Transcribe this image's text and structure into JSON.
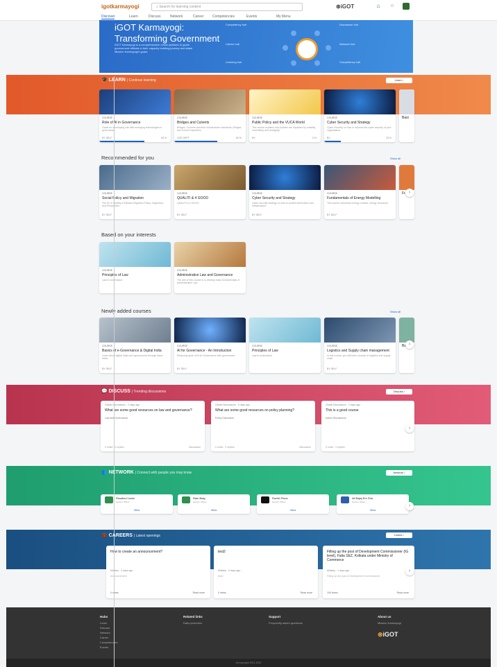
{
  "header": {
    "logo": "igotkarmayogi",
    "search_placeholder": "Search for learning content",
    "brand": "iGOT",
    "nav": [
      "Discover",
      "Learn",
      "Discuss",
      "Network",
      "Career",
      "Competencies",
      "Events",
      "My Menu"
    ]
  },
  "hero": {
    "title_line1": "iGOT Karmayogi:",
    "title_line2": "Transforming Government",
    "description": "iGOT Karmayogi is a comprehensive online platform to guide government officials in their capacity building journey and attain Mission Karmayogi's goals.",
    "labels": [
      "Competency hub",
      "Discussion hub",
      "Career hub",
      "Network hub",
      "Learning hub",
      "Competency hub"
    ]
  },
  "learn": {
    "title": "LEARN",
    "subtitle": "Continue learning",
    "button": "Learn",
    "cards": [
      {
        "tag": "COURSE",
        "title": "Role of AI in Governance",
        "desc": "Guide for developing role with emerging technologies in governance.",
        "meta": "BY SELF",
        "progress": "63 %"
      },
      {
        "tag": "COURSE",
        "title": "Bridges and Culverts",
        "desc": "Bridges, Culverts and their maintenance standards, Bridges and Culvert Inspection",
        "meta": "CDE DEPT",
        "progress": "60 %"
      },
      {
        "tag": "COURSE",
        "title": "Public Policy and the VUCA World",
        "desc": "This course explains how policies are impacted by volatility, uncertainty and ambiguity.",
        "meta": "BV",
        "progress": "0 %"
      },
      {
        "tag": "COURSE",
        "title": "Cyber Security and Strategy",
        "desc": "Cyber Security on how to improve the cyber security of your organisation.",
        "meta": "BV",
        "progress": "23 %"
      },
      {
        "tag": "COURSE",
        "title": "Basi",
        "desc": "",
        "meta": "",
        "progress": ""
      }
    ]
  },
  "recommended": {
    "title": "Recommended for you",
    "see_all": "Show all",
    "cards": [
      {
        "tag": "COURSE",
        "title": "Social Policy and Migration",
        "desc": "The IIC & Mobility & Efficient Migration Policy: Objectives and Perspective",
        "meta": "BY SELF"
      },
      {
        "tag": "COURSE",
        "title": "QUALITI & 4 GOOD",
        "desc": "QUALITI & 4 GOOD",
        "meta": "BY SELF"
      },
      {
        "tag": "COURSE",
        "title": "Cyber Security and Strategy",
        "desc": "Cyber security strategy on how to protect information and infrastructure",
        "meta": "BY SELF"
      },
      {
        "tag": "COURSE",
        "title": "Fundamentals of Energy Modelling",
        "desc": "This course introduces energy models, energy resources",
        "meta": "BY SELF"
      },
      {
        "tag": "COURSE",
        "title": "Fram",
        "desc": "",
        "meta": ""
      }
    ]
  },
  "interests": {
    "title": "Based on your interests",
    "cards": [
      {
        "tag": "COURSE",
        "title": "Principles of Law",
        "desc": "Law to understand",
        "meta": ""
      },
      {
        "tag": "COURSE",
        "title": "Administrative Law and Governance",
        "desc": "The aim of this course is to develop basic fundamentals of Administrative Law",
        "meta": ""
      }
    ]
  },
  "newly": {
    "title": "Newly added courses",
    "see_all": "Show all",
    "cards": [
      {
        "tag": "COURSE",
        "title": "Basics of e-Governance & Digital India",
        "desc": "Learn about digital India and egovernance through basic ideas",
        "meta": "BY SELF"
      },
      {
        "tag": "COURSE",
        "title": "AI for Governance - An Introduction",
        "desc": "Reducing cycle of AI for Governance with government",
        "meta": "BY SELF"
      },
      {
        "tag": "COURSE",
        "title": "Principles of Law",
        "desc": "Law to understand",
        "meta": ""
      },
      {
        "tag": "COURSE",
        "title": "Logistics and Supply chain management",
        "desc": "In this course, you will learn concept of logistics and supply chain",
        "meta": "BY SELF"
      },
      {
        "tag": "COURSE",
        "title": "Basi",
        "desc": "",
        "meta": ""
      }
    ]
  },
  "discuss": {
    "title": "DISCUSS",
    "subtitle": "Trending discussions",
    "button": "Discuss",
    "cards": [
      {
        "by": "Global Discussions · 2 days ago",
        "question": "What are some good resources on law and governance?",
        "category": "Law and Governance",
        "upvotes": "0 votes",
        "replies": "0 replies",
        "posted": "Discussion"
      },
      {
        "by": "Global Discussions · 5 days ago",
        "question": "What are some good resources on policy planning?",
        "category": "Policy Discussion",
        "upvotes": "0 votes",
        "replies": "0 replies",
        "posted": "Discussion"
      },
      {
        "by": "Global Discussions · 2 days ago",
        "question": "This is a good course",
        "category": "Admin Discussions",
        "upvotes": "0 votes",
        "replies": "0 replies",
        "posted": "Discussion"
      }
    ]
  },
  "network": {
    "title": "NETWORK",
    "subtitle": "Connect with people you may know",
    "button": "Network",
    "people": [
      {
        "initials": "RL",
        "name": "Rosalind Lewin",
        "desc": "Section Officer",
        "view": "View"
      },
      {
        "initials": "RB",
        "name": "Ram Baig",
        "desc": "Section Officer",
        "view": "View"
      },
      {
        "initials": "RP",
        "name": "Ruchit Pious",
        "desc": "Section Officer",
        "view": "View"
      },
      {
        "initials": "AB",
        "name": "Ali Bajaj Ere Sha",
        "desc": "Section Officer",
        "view": "View"
      }
    ]
  },
  "careers": {
    "title": "CAREERS",
    "subtitle": "Latest openings",
    "button": "Career",
    "cards": [
      {
        "question": "How to create an announcement?",
        "by": "Ministry · 2 days ago",
        "cat": "Announcement",
        "ft": "0 views",
        "ft2": "Read more"
      },
      {
        "question": "test2",
        "by": "Ministry · 5 days ago",
        "cat": "test2",
        "ft": "0 views",
        "ft2": "Read more"
      },
      {
        "question": "Filling up the post of Development Commissioner (IG level), Falta SEZ, Kolkata under Ministry of Commerce",
        "by": "Ministry · 1 days ago",
        "cat": "Filling up the post of Development Commissioner",
        "ft": "100 views",
        "ft2": "Read more"
      }
    ]
  },
  "footer": {
    "cols": [
      {
        "heading": "Hubs",
        "links": [
          "Learn",
          "Discuss",
          "Network",
          "Career",
          "Competencies",
          "Events"
        ]
      },
      {
        "heading": "Related links",
        "links": [
          "Data protection"
        ]
      },
      {
        "heading": "Support",
        "links": [
          "Frequently asked questions"
        ]
      },
      {
        "heading": "About us",
        "links": [
          "Mission Karmayogi"
        ]
      }
    ],
    "brand": "iGOT",
    "copyright": "All copyright 2021-2022"
  },
  "colors": {
    "learn": "#e6622f",
    "discuss": "#c23a55",
    "network": "#27a879",
    "careers": "#1f5f95",
    "hero": "#2f76cf"
  }
}
